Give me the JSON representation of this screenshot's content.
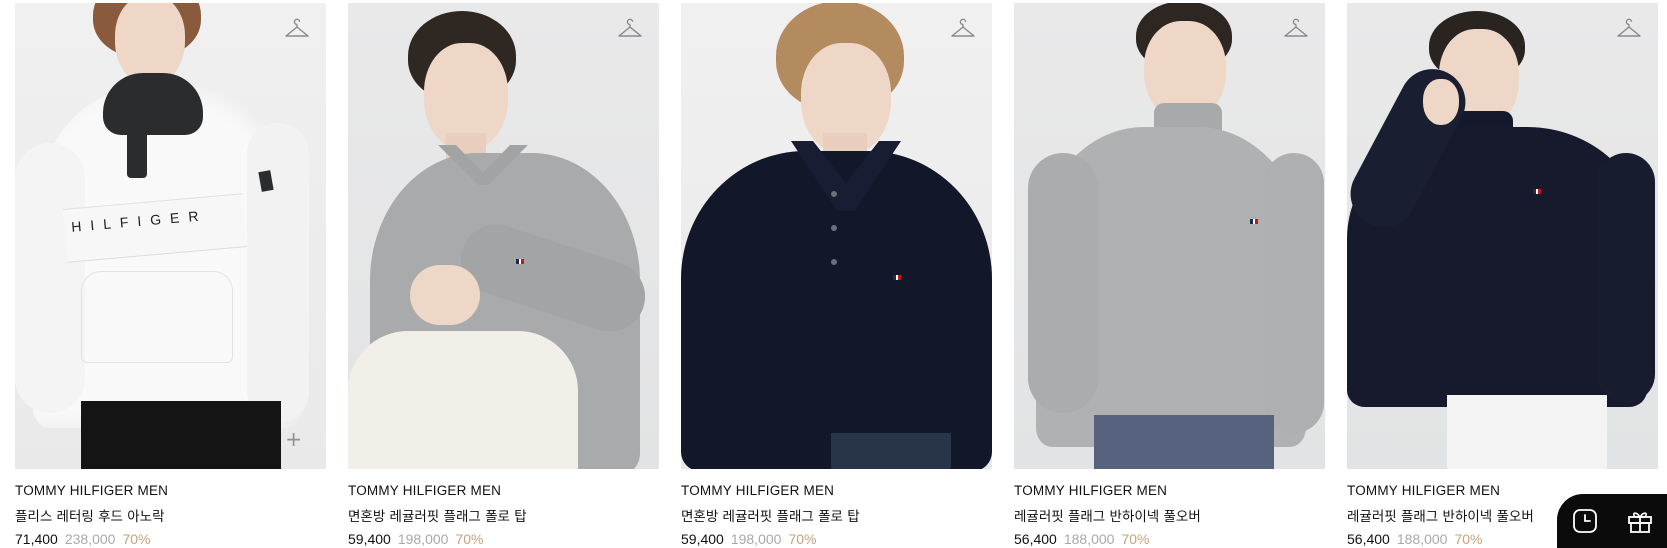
{
  "products": [
    {
      "brand": "TOMMY HILFIGER MEN",
      "name": "플리스 레터링 후드 아노락",
      "price": "71,400",
      "original_price": "238,000",
      "discount": "70%",
      "chest_text": "HILFIGER"
    },
    {
      "brand": "TOMMY HILFIGER MEN",
      "name": "면혼방 레귤러핏 플래그 폴로 탑",
      "price": "59,400",
      "original_price": "198,000",
      "discount": "70%"
    },
    {
      "brand": "TOMMY HILFIGER MEN",
      "name": "면혼방 레귤러핏 플래그 폴로 탑",
      "price": "59,400",
      "original_price": "198,000",
      "discount": "70%"
    },
    {
      "brand": "TOMMY HILFIGER MEN",
      "name": "레귤러핏 플래그 반하이넥 풀오버",
      "price": "56,400",
      "original_price": "188,000",
      "discount": "70%"
    },
    {
      "brand": "TOMMY HILFIGER MEN",
      "name": "레귤러핏 플래그 반하이넥 풀오버",
      "price": "56,400",
      "original_price": "188,000",
      "discount": "70%"
    }
  ],
  "icons": {
    "wishlist": "hanger-icon",
    "quick_add": "plus-icon",
    "recent": "clock-icon",
    "gift": "gift-icon"
  },
  "quick_add_glyph": "+",
  "colors": {
    "discount": "#c7a27a",
    "original_price": "#a9a9a9",
    "floating_bar": "#0b0b0b"
  }
}
